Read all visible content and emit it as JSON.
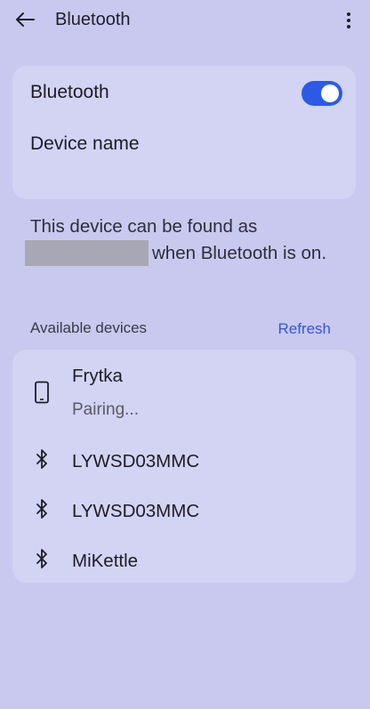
{
  "header": {
    "title": "Bluetooth",
    "back_icon": "arrow-left-icon",
    "more_icon": "more-vert-icon"
  },
  "bluetooth": {
    "label": "Bluetooth",
    "enabled": true,
    "device_name_label": "Device name"
  },
  "info": {
    "prefix": "This device can be found as",
    "suffix": "when Bluetooth is on."
  },
  "available": {
    "label": "Available devices",
    "refresh_label": "Refresh",
    "devices": [
      {
        "name": "Frytka",
        "status": "Pairing...",
        "icon": "phone-icon"
      },
      {
        "name": "LYWSD03MMC",
        "icon": "bluetooth-icon"
      },
      {
        "name": "LYWSD03MMC",
        "icon": "bluetooth-icon"
      },
      {
        "name": "MiKettle",
        "icon": "bluetooth-icon"
      }
    ]
  },
  "colors": {
    "background": "#c9c9ef",
    "card": "#d3d3f3",
    "accent": "#2b5be6",
    "link": "#3258d6"
  }
}
